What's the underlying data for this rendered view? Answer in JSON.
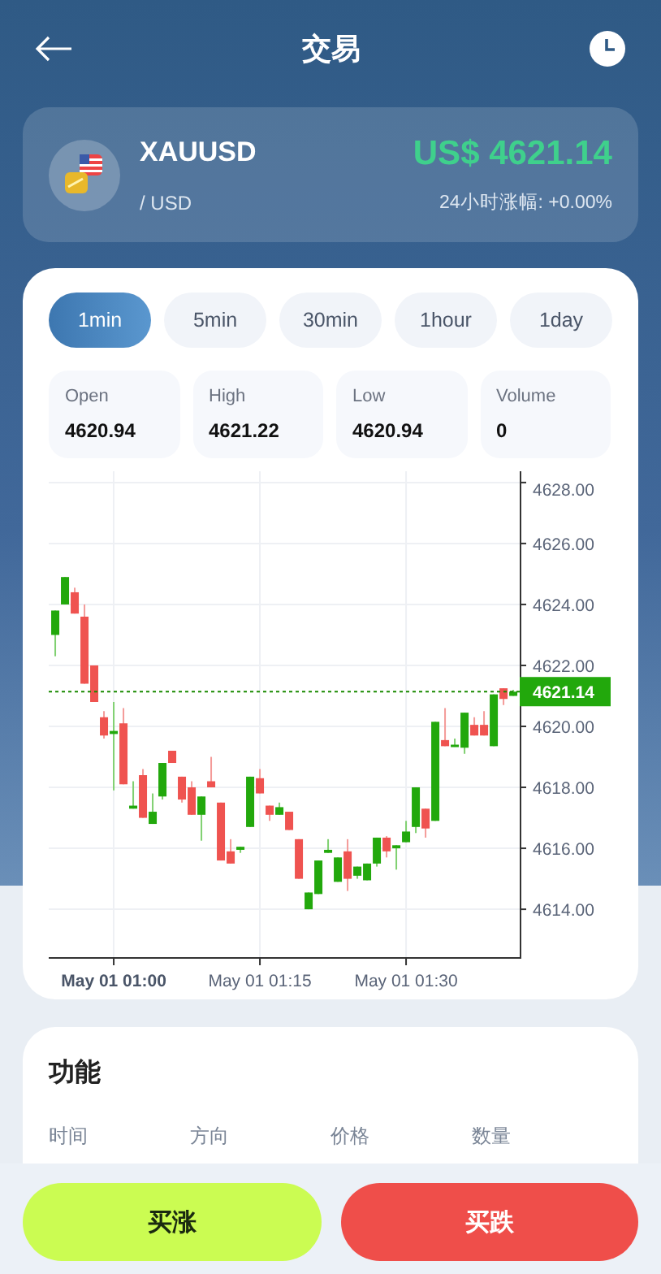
{
  "header": {
    "title": "交易"
  },
  "asset": {
    "symbol": "XAUUSD",
    "quote": "/ USD",
    "price": "US$ 4621.14",
    "change_label": "24小时涨幅: +0.00%"
  },
  "intervals": [
    {
      "label": "1min",
      "selected": true
    },
    {
      "label": "5min",
      "selected": false
    },
    {
      "label": "30min",
      "selected": false
    },
    {
      "label": "1hour",
      "selected": false
    },
    {
      "label": "1day",
      "selected": false
    }
  ],
  "stats": [
    {
      "label": "Open",
      "value": "4620.94"
    },
    {
      "label": "High",
      "value": "4621.22"
    },
    {
      "label": "Low",
      "value": "4620.94"
    },
    {
      "label": "Volume",
      "value": "0"
    }
  ],
  "chart": {
    "chart_data": {
      "type": "candlestick",
      "grid": true,
      "ylim": [
        4612.43,
        4628.37
      ],
      "ref_lines": [
        {
          "axis": "y",
          "value": 4621.14,
          "label": "4621.14"
        }
      ],
      "categories": [
        null,
        null,
        null,
        null,
        null,
        null,
        "May 01 01:00",
        null,
        null,
        null,
        null,
        null,
        null,
        null,
        null,
        null,
        null,
        null,
        null,
        null,
        null,
        "May 01 01:15",
        null,
        null,
        null,
        null,
        null,
        null,
        null,
        null,
        null,
        null,
        null,
        null,
        null,
        null,
        "May 01 01:30",
        null,
        null,
        null,
        null,
        null,
        null,
        null,
        null,
        null,
        null,
        null
      ],
      "ohlc": [
        [
          4623.0,
          4623.8,
          4622.3,
          4623.8
        ],
        [
          4624.0,
          4624.9,
          4624.0,
          4624.9
        ],
        [
          4624.4,
          4624.55,
          4623.7,
          4623.7
        ],
        [
          4623.6,
          4624.0,
          4621.4,
          4621.4
        ],
        [
          4622.0,
          4622.0,
          4620.8,
          4620.8
        ],
        [
          4620.3,
          4620.5,
          4619.6,
          4619.7
        ],
        [
          4619.75,
          4620.8,
          4617.9,
          4619.85
        ],
        [
          4620.1,
          4620.6,
          4618.1,
          4618.1
        ],
        [
          4617.3,
          4618.2,
          4617.3,
          4617.4
        ],
        [
          4618.4,
          4618.6,
          4617.0,
          4617.0
        ],
        [
          4616.8,
          4617.8,
          4616.8,
          4617.2
        ],
        [
          4617.7,
          4618.8,
          4617.6,
          4618.8
        ],
        [
          4619.2,
          4619.2,
          4618.8,
          4618.8
        ],
        [
          4618.35,
          4618.35,
          4617.5,
          4617.6
        ],
        [
          4618.0,
          4618.2,
          4617.1,
          4617.1
        ],
        [
          4617.1,
          4617.7,
          4616.25,
          4617.7
        ],
        [
          4618.2,
          4619.0,
          4618.0,
          4618.0
        ],
        [
          4617.5,
          4617.5,
          4615.6,
          4615.6
        ],
        [
          4615.9,
          4616.3,
          4615.5,
          4615.5
        ],
        [
          4615.95,
          4616.05,
          4615.85,
          4616.05
        ],
        [
          4616.7,
          4618.35,
          4616.7,
          4618.35
        ],
        [
          4618.3,
          4618.6,
          4617.8,
          4617.8
        ],
        [
          4617.4,
          4617.4,
          4616.9,
          4617.1
        ],
        [
          4617.1,
          4617.5,
          4617.1,
          4617.35
        ],
        [
          4617.2,
          4617.2,
          4616.6,
          4616.6
        ],
        [
          4616.3,
          4616.3,
          4615.0,
          4615.0
        ],
        [
          4614.0,
          4614.55,
          4614.0,
          4614.55
        ],
        [
          4614.5,
          4615.6,
          4614.5,
          4615.6
        ],
        [
          4615.85,
          4616.3,
          4615.85,
          4615.95
        ],
        [
          4614.9,
          4615.7,
          4614.9,
          4615.7
        ],
        [
          4615.9,
          4616.3,
          4614.6,
          4615.0
        ],
        [
          4615.1,
          4615.4,
          4615.0,
          4615.4
        ],
        [
          4614.95,
          4615.5,
          4614.95,
          4615.5
        ],
        [
          4615.5,
          4616.35,
          4615.4,
          4616.35
        ],
        [
          4616.35,
          4616.4,
          4615.7,
          4615.9
        ],
        [
          4616.0,
          4616.1,
          4615.3,
          4616.1
        ],
        [
          4616.2,
          4616.9,
          4616.2,
          4616.55
        ],
        [
          4616.7,
          4618.0,
          4616.5,
          4618.0
        ],
        [
          4617.3,
          4617.3,
          4616.35,
          4616.65
        ],
        [
          4616.9,
          4620.15,
          4616.9,
          4620.15
        ],
        [
          4619.55,
          4620.6,
          4619.35,
          4619.35
        ],
        [
          4619.33,
          4619.6,
          4619.33,
          4619.4
        ],
        [
          4619.3,
          4620.45,
          4619.1,
          4620.45
        ],
        [
          4620.05,
          4620.3,
          4619.7,
          4619.7
        ],
        [
          4620.05,
          4620.5,
          4619.7,
          4619.7
        ],
        [
          4619.35,
          4621.05,
          4619.35,
          4621.05
        ],
        [
          4621.25,
          4621.25,
          4620.7,
          4620.9
        ],
        [
          4621.0,
          4621.2,
          4621.0,
          4621.14
        ]
      ],
      "yticks": [
        {
          "value": 4628,
          "label": "4628.00"
        },
        {
          "value": 4626,
          "label": "4626.00"
        },
        {
          "value": 4624,
          "label": "4624.00"
        },
        {
          "value": 4622,
          "label": "4622.00"
        },
        {
          "value": 4620,
          "label": "4620.00"
        },
        {
          "value": 4618,
          "label": "4618.00"
        },
        {
          "value": 4616,
          "label": "4616.00"
        },
        {
          "value": 4614,
          "label": "4614.00"
        }
      ]
    }
  },
  "functions": {
    "title": "功能",
    "columns": [
      "时间",
      "方向",
      "价格",
      "数量"
    ]
  },
  "actions": [
    {
      "label": "买涨",
      "kind": "buy"
    },
    {
      "label": "买跌",
      "kind": "sell"
    }
  ]
}
